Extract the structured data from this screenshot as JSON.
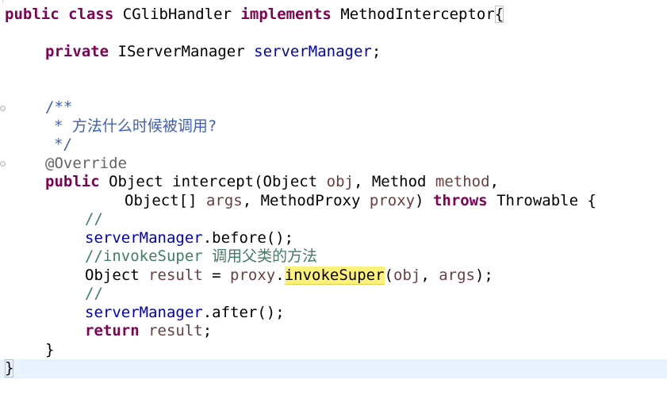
{
  "editor": {
    "lines": {
      "class_decl": {
        "kw_public": "public",
        "kw_class": "class",
        "class_name": "CGlibHandler",
        "kw_implements": "implements",
        "interface_name": "MethodInterceptor",
        "open_brace": "{"
      },
      "field_decl": {
        "kw_private": "private",
        "type": "IServerManager",
        "field_name": "serverManager",
        "semicolon": ";"
      },
      "javadoc": {
        "start": "/**",
        "body": "* 方法什么时候被调用?",
        "end": "*/"
      },
      "annotation": "@Override",
      "method_sig_1": {
        "kw_public": "public",
        "rest_a": "Object intercept(Object ",
        "param_obj": "obj",
        "rest_b": ", Method ",
        "param_method": "method",
        "comma": ","
      },
      "method_sig_2": {
        "rest_a": "Object[] ",
        "param_args": "args",
        "rest_b": ", MethodProxy ",
        "param_proxy": "proxy",
        "close_paren": ")",
        "kw_throws": "throws",
        "exception": "Throwable {"
      },
      "comment_1": "//",
      "before_call": {
        "field": "serverManager",
        "call": ".before();"
      },
      "comment_2": "//invokeSuper 调用父类的方法",
      "result_line": {
        "type": "Object ",
        "var_result": "result",
        "eq": " = ",
        "var_proxy": "proxy",
        "dot": ".",
        "method": "invokeSuper",
        "open": "(",
        "arg_obj": "obj",
        "comma": ", ",
        "arg_args": "args",
        "close": ");"
      },
      "comment_3": "//",
      "after_call": {
        "field": "serverManager",
        "call": ".after();"
      },
      "return_line": {
        "kw_return": "return",
        "var_result": "result",
        "semicolon": ";"
      },
      "method_close": "}",
      "class_close": "}"
    }
  }
}
